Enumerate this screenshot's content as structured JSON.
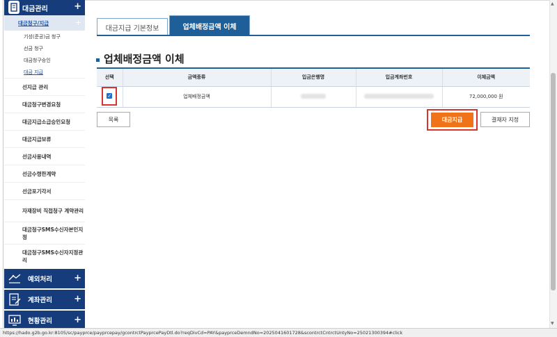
{
  "sidebar": {
    "header": {
      "label": "대금관리",
      "icon": "building-icon"
    },
    "sub_title": "대금청구/지급",
    "sub_items": [
      {
        "label": "기성(준공)금 청구",
        "active": false
      },
      {
        "label": "선금 청구",
        "active": false
      },
      {
        "label": "대금청구승인",
        "active": false
      },
      {
        "label": "대금 지급",
        "active": true
      }
    ],
    "menu_items": [
      "선지급 관리",
      "대금청구변경요청",
      "대금지급소급승인요청",
      "대금지급보류",
      "선금사용내역",
      "선금수령한계약",
      "선금포기각서",
      "자재장비 직접청구 계약관리",
      "대금청구SMS수신자본인지정",
      "대금청구SMS수신자지정관리"
    ],
    "categories": [
      {
        "label": "예외처리",
        "icon": "exception-icon"
      },
      {
        "label": "계좌관리",
        "icon": "account-icon"
      },
      {
        "label": "현황관리",
        "icon": "status-icon"
      }
    ],
    "plus": "+"
  },
  "tabs": [
    {
      "label": "대금지급 기본정보",
      "active": false
    },
    {
      "label": "업체배정금액 이체",
      "active": true
    }
  ],
  "section": {
    "title": "업체배정금액 이체"
  },
  "table": {
    "headers": [
      "선택",
      "금액종류",
      "입금은행명",
      "입금계좌번호",
      "이체금액"
    ],
    "rows": [
      {
        "checked": true,
        "amount_type": "업체배정금액",
        "bank": "",
        "account": "",
        "amount": "72,000,000 원"
      }
    ]
  },
  "buttons": {
    "list": "목록",
    "pay": "대금지급",
    "approver": "결재자 지정"
  },
  "status_url": "https://hado.g2b.go.kr:8105/sc/payprce/payprcepay/gcontrctPayprcePayDtl.do?reqDivCd=PAY&payprceDemndNo=2025041601728&scontrctCntrctUntyNo=25021300394#click",
  "colors": {
    "nav": "#163c7b",
    "accent": "#1e5f99",
    "pay_button": "#f07319",
    "highlight": "#d9332e"
  }
}
